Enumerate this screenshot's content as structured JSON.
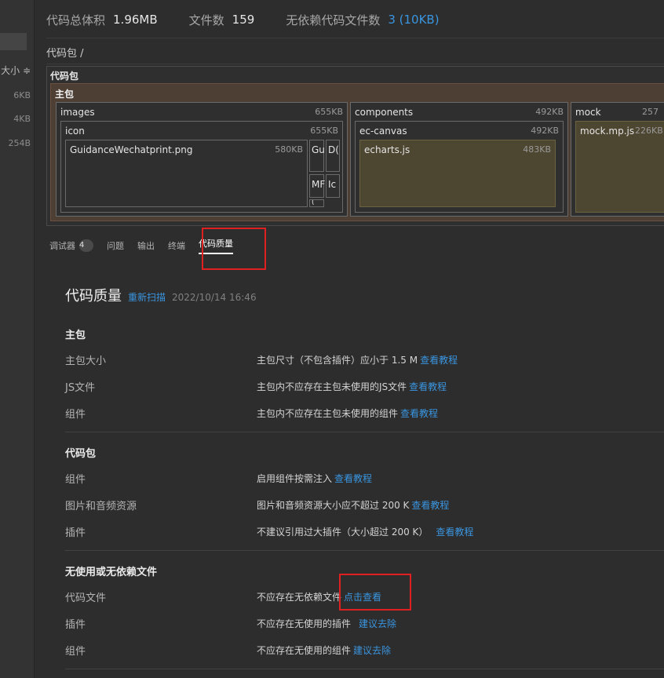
{
  "left_panel": {
    "sort_label": "大小 ≑",
    "sizes": [
      "6KB",
      "4KB",
      "254B"
    ]
  },
  "stats": {
    "total_label": "代码总体积",
    "total_value": "1.96MB",
    "files_label": "文件数",
    "files_value": "159",
    "nodep_label": "无依赖代码文件数",
    "nodep_value": "3 (10KB)"
  },
  "breadcrumb": "代码包 /",
  "treemap": {
    "root": "代码包",
    "main_package": "主包",
    "images": {
      "name": "images",
      "size": "655KB"
    },
    "icon": {
      "name": "icon",
      "size": "655KB"
    },
    "guidance": {
      "name": "GuidanceWechatprint.png",
      "size": "580KB"
    },
    "small_tiles": [
      "Gu",
      "D(",
      "MF",
      "Ic",
      "("
    ],
    "components": {
      "name": "components",
      "size": "492KB"
    },
    "ec_canvas": {
      "name": "ec-canvas",
      "size": "492KB"
    },
    "echarts": {
      "name": "echarts.js",
      "size": "483KB"
    },
    "mock": {
      "name": "mock",
      "size": "257"
    },
    "mock_file": {
      "name": "mock.mp.js",
      "size": "226KB"
    }
  },
  "tabs": {
    "debugger": "调试器",
    "debugger_count": "4",
    "issues": "问题",
    "output": "输出",
    "terminal": "终端",
    "code_quality": "代码质量"
  },
  "code_quality": {
    "title": "代码质量",
    "rescan": "重新扫描",
    "timestamp": "2022/10/14 16:46",
    "sections": {
      "main": {
        "heading": "主包",
        "rows": [
          {
            "key": "主包大小",
            "value": "主包尺寸（不包含插件）应小于 1.5 M",
            "link": "查看教程"
          },
          {
            "key": "JS文件",
            "value": "主包内不应存在主包未使用的JS文件",
            "link": "查看教程"
          },
          {
            "key": "组件",
            "value": "主包内不应存在主包未使用的组件",
            "link": "查看教程"
          }
        ]
      },
      "package": {
        "heading": "代码包",
        "rows": [
          {
            "key": "组件",
            "value": "启用组件按需注入",
            "link": "查看教程"
          },
          {
            "key": "图片和音频资源",
            "value": "图片和音频资源大小应不超过 200 K",
            "link": "查看教程"
          },
          {
            "key": "插件",
            "value": "不建议引用过大插件（大小超过 200 K）",
            "link": "查看教程"
          }
        ]
      },
      "unused": {
        "heading": "无使用或无依赖文件",
        "rows": [
          {
            "key": "代码文件",
            "value": "不应存在无依赖文件",
            "link": "点击查看"
          },
          {
            "key": "插件",
            "value": "不应存在无使用的插件",
            "link": "建议去除"
          },
          {
            "key": "组件",
            "value": "不应存在无使用的组件",
            "link": "建议去除"
          }
        ]
      }
    }
  },
  "colors": {
    "link": "#3a95e0",
    "highlight": "#e02020",
    "main_pkg": "#4e3f35",
    "olive": "#4d4630"
  }
}
